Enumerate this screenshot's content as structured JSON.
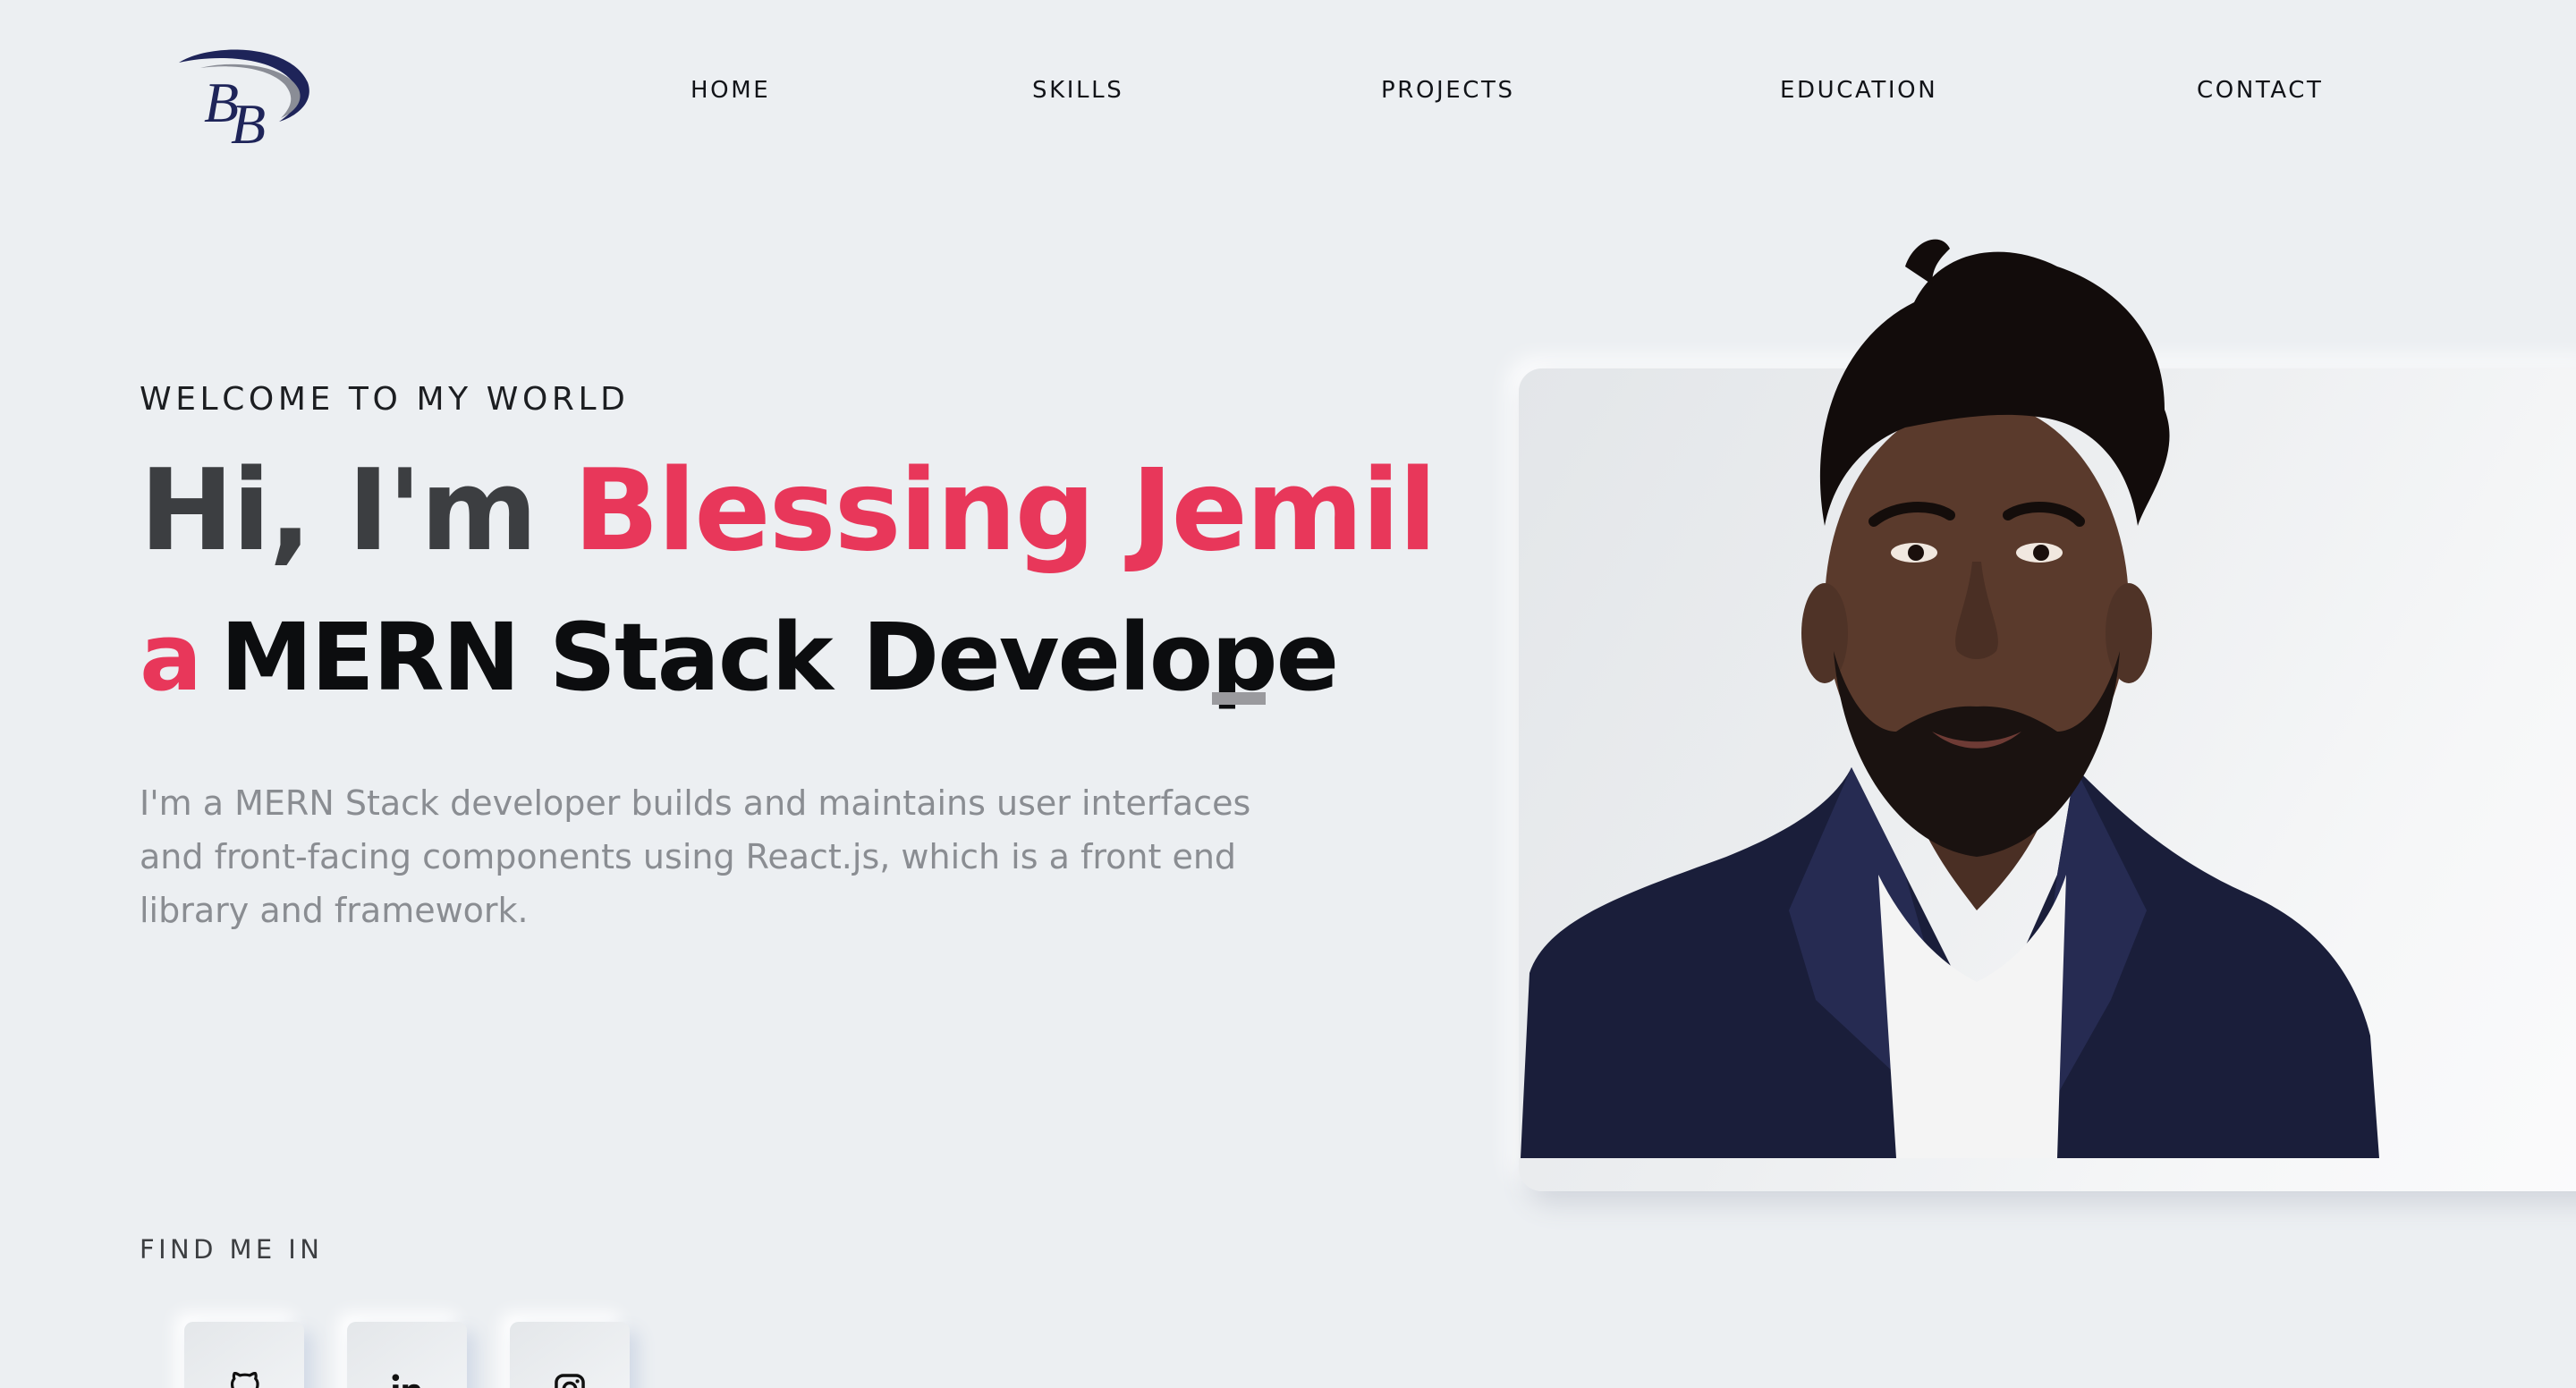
{
  "brand": {
    "logo_text": "BB",
    "logo_icon": "bb-monogram-logo",
    "colors": {
      "navy": "#1e2459",
      "swoosh": "#8a8d96"
    }
  },
  "nav": {
    "items": [
      {
        "label": "HOME"
      },
      {
        "label": "SKILLS"
      },
      {
        "label": "PROJECTS"
      },
      {
        "label": "EDUCATION"
      },
      {
        "label": "CONTACT"
      }
    ]
  },
  "hero": {
    "eyebrow": "WELCOME TO MY WORLD",
    "greeting": "Hi, I'm ",
    "name": "Blessing Jemil",
    "role_article": "a",
    "role_text": "MERN Stack Develope",
    "description": "I'm a MERN Stack developer builds and maintains user interfaces and front-facing components using React.js, which is a front end library and framework."
  },
  "social": {
    "label": "FIND ME IN",
    "links": [
      {
        "icon": "github-icon"
      },
      {
        "icon": "linkedin-icon"
      },
      {
        "icon": "instagram-icon"
      }
    ]
  },
  "portrait": {
    "icon": "person-portrait"
  },
  "theme": {
    "accent": "#e8375a",
    "background": "#eceff2",
    "heading": "#3c3e41",
    "muted": "#8a8d92"
  }
}
